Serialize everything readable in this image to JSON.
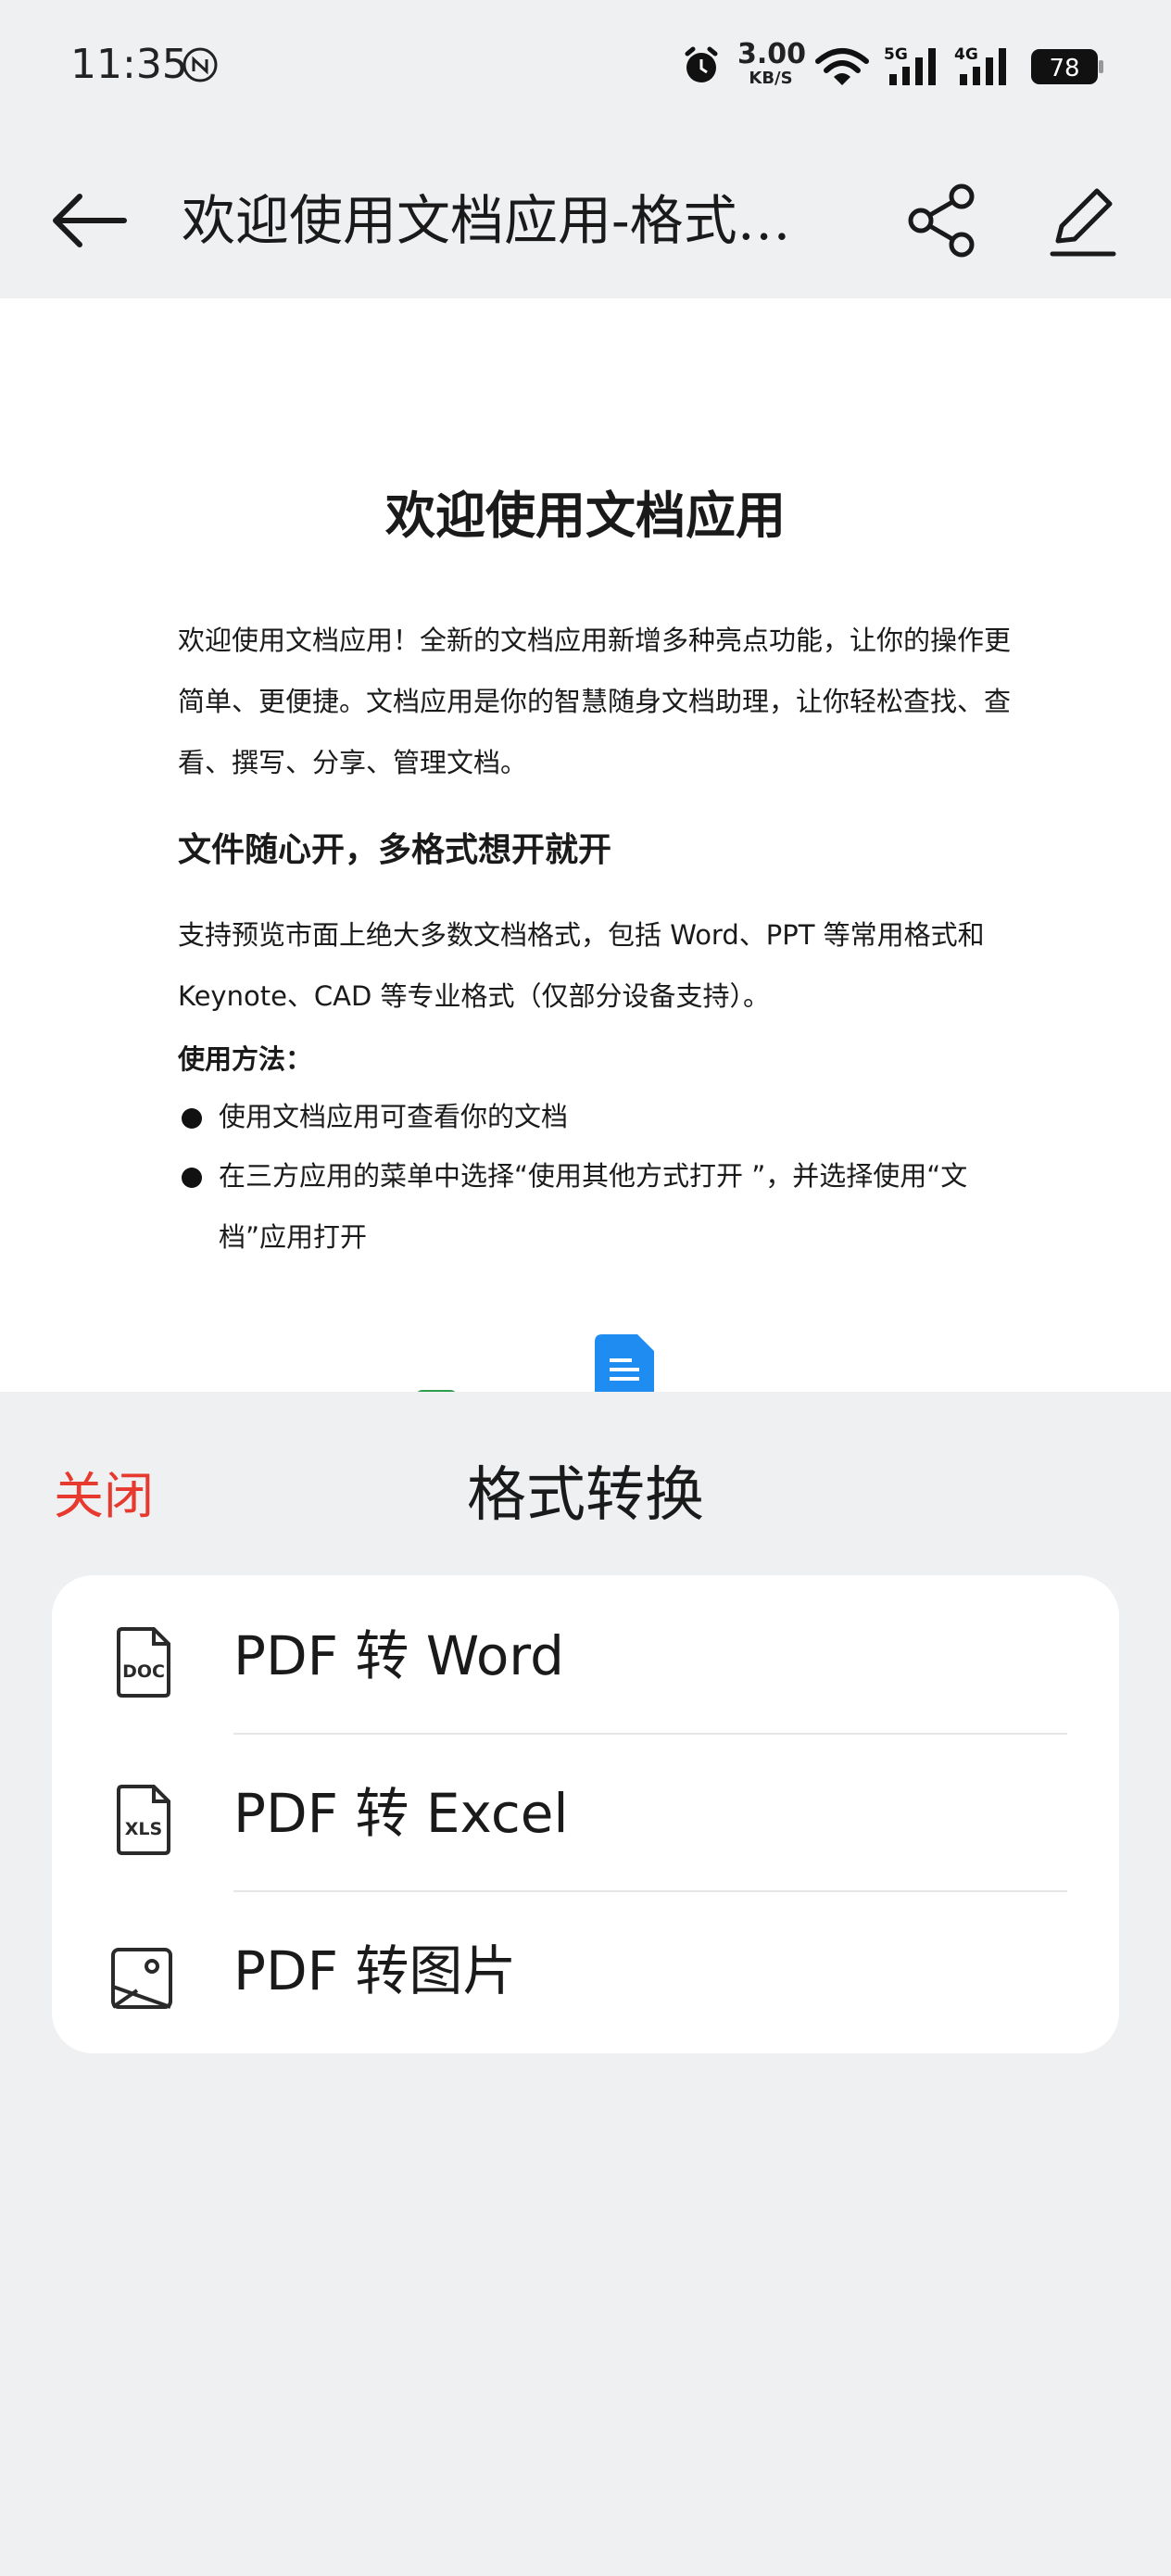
{
  "status_bar": {
    "time": "11:35",
    "net_speed_value": "3.00",
    "net_speed_unit": "KB/S",
    "sim1_label": "5G",
    "sim2_label": "4G",
    "battery": "78",
    "icons": [
      "nfc-icon",
      "alarm-icon",
      "wifi-icon",
      "signal-icon",
      "signal-icon",
      "battery-icon"
    ]
  },
  "app_bar": {
    "title": "欢迎使用文档应用-格式…",
    "icons": [
      "back-arrow-icon",
      "share-icon",
      "edit-pencil-icon"
    ]
  },
  "document": {
    "heading": "欢迎使用文档应用",
    "intro": "欢迎使用文档应用！全新的文档应用新增多种亮点功能，让你的操作更简单、更便捷。文档应用是你的智慧随身文档助理，让你轻松查找、查看、撰写、分享、管理文档。",
    "subheading": "文件随心开，多格式想开就开",
    "formats_text": "支持预览市面上绝大多数文档格式，包括 Word、PPT 等常用格式和 Keynote、CAD 等专业格式（仅部分设备支持）。",
    "usage_label": "使用方法：",
    "bullets": [
      "使用文档应用可查看你的文档",
      "在三方应用的菜单中选择“使用其他方式打开 ”，并选择使用“文档”应用打开"
    ]
  },
  "sheet": {
    "close_label": "关闭",
    "title": "格式转换",
    "options": [
      {
        "label": "PDF 转 Word",
        "icon": "doc-file-icon",
        "icon_text": "DOC"
      },
      {
        "label": "PDF 转 Excel",
        "icon": "xls-file-icon",
        "icon_text": "XLS"
      },
      {
        "label": "PDF 转图片",
        "icon": "image-icon"
      }
    ]
  },
  "colors": {
    "close_red": "#e8392f",
    "doc_blue": "#1e8cf0",
    "sheet_bg": "#eef0f2"
  }
}
